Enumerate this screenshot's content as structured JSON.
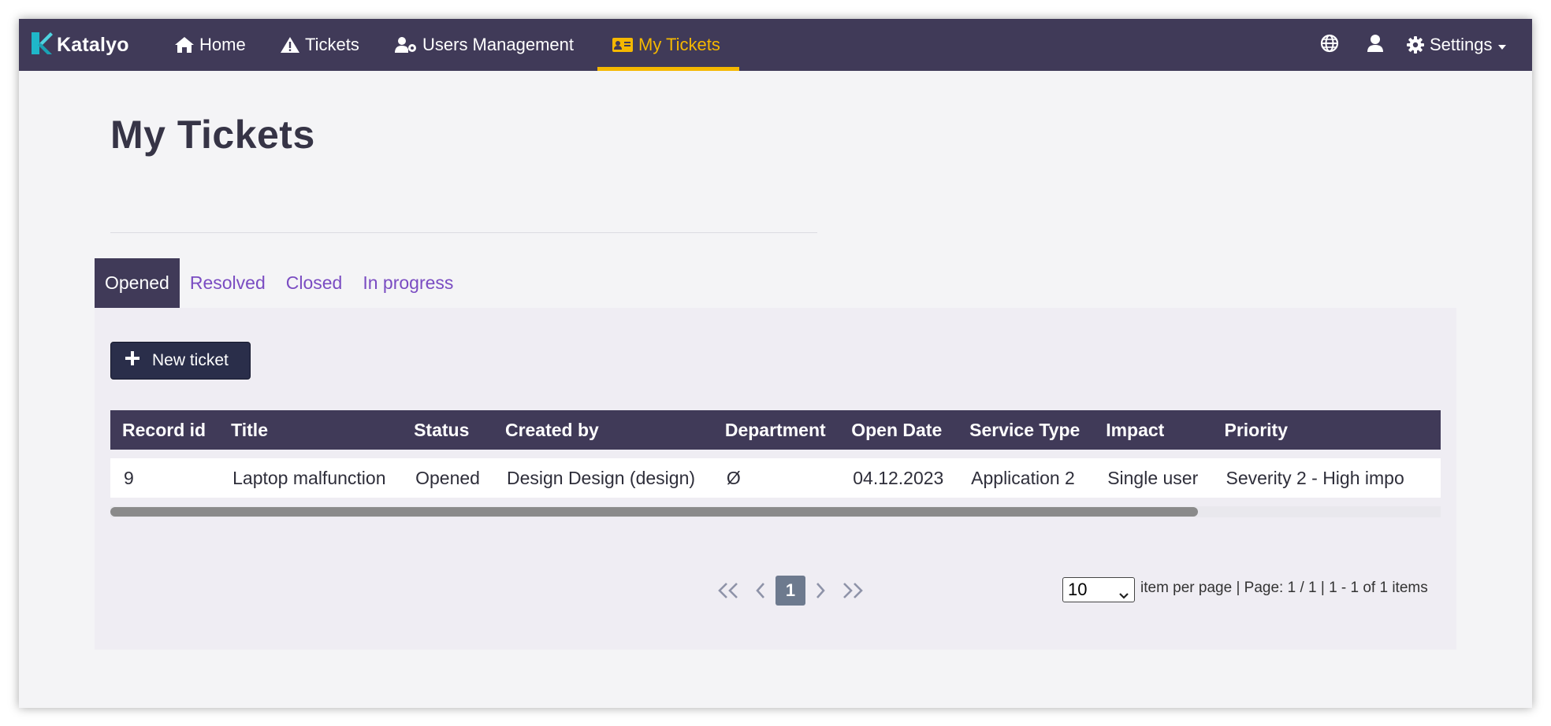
{
  "navbar": {
    "brand": "Katalyo",
    "items": [
      {
        "label": "Home",
        "icon": "home-icon"
      },
      {
        "label": "Tickets",
        "icon": "warning-icon"
      },
      {
        "label": "Users Management",
        "icon": "user-gear-icon"
      },
      {
        "label": "My Tickets",
        "icon": "id-card-icon",
        "active": true
      }
    ],
    "settings_label": "Settings",
    "colors": {
      "background": "#403a58",
      "accent": "#f5b800"
    }
  },
  "page": {
    "title": "My Tickets"
  },
  "tabs": [
    {
      "label": "Opened",
      "active": true
    },
    {
      "label": "Resolved"
    },
    {
      "label": "Closed"
    },
    {
      "label": "In progress"
    }
  ],
  "toolbar": {
    "new_ticket_label": "New ticket"
  },
  "table": {
    "columns": [
      "Record id",
      "Title",
      "Status",
      "Created by",
      "Department",
      "Open Date",
      "Service Type",
      "Impact",
      "Priority"
    ],
    "rows": [
      [
        "9",
        "Laptop malfunction",
        "Opened",
        "Design Design (design)",
        "Ø",
        "04.12.2023",
        "Application 2",
        "Single user",
        "Severity 2 - High impo"
      ]
    ]
  },
  "pagination": {
    "current_page": "1",
    "page_size": "10",
    "info": "item per page | Page: 1 / 1 | 1 - 1 of 1 items"
  }
}
